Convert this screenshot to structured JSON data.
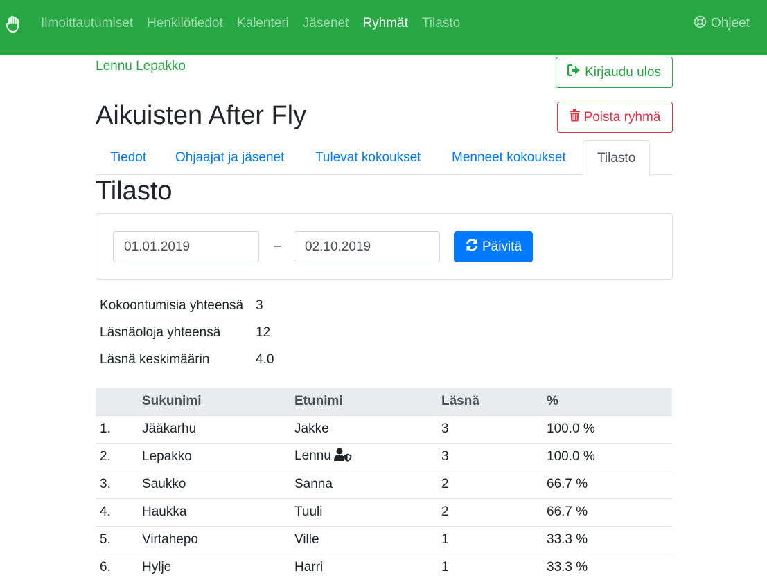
{
  "nav": {
    "items": [
      {
        "label": "Ilmoittautumiset",
        "active": false
      },
      {
        "label": "Henkilötiedot",
        "active": false
      },
      {
        "label": "Kalenteri",
        "active": false
      },
      {
        "label": "Jäsenet",
        "active": false
      },
      {
        "label": "Ryhmät",
        "active": true
      },
      {
        "label": "Tilasto",
        "active": false
      }
    ],
    "help_label": "Ohjeet",
    "brand_icon": "hand-icon"
  },
  "user": {
    "name": "Lennu Lepakko",
    "logout_label": "Kirjaudu ulos"
  },
  "group": {
    "title": "Aikuisten After Fly",
    "delete_label": "Poista ryhmä"
  },
  "tabs": [
    {
      "label": "Tiedot",
      "active": false
    },
    {
      "label": "Ohjaajat ja jäsenet",
      "active": false
    },
    {
      "label": "Tulevat kokoukset",
      "active": false
    },
    {
      "label": "Menneet kokoukset",
      "active": false
    },
    {
      "label": "Tilasto",
      "active": true
    }
  ],
  "stats_section": {
    "title": "Tilasto",
    "date_from": "01.01.2019",
    "date_separator": "–",
    "date_to": "02.10.2019",
    "refresh_label": "Päivitä"
  },
  "summary": [
    {
      "label": "Kokoontumisia yhteensä",
      "value": "3"
    },
    {
      "label": "Läsnäoloja yhteensä",
      "value": "12"
    },
    {
      "label": "Läsnä keskimäärin",
      "value": "4.0"
    }
  ],
  "table": {
    "headers": [
      "",
      "Sukunimi",
      "Etunimi",
      "Läsnä",
      "%"
    ],
    "rows": [
      {
        "n": "1.",
        "last": "Jääkarhu",
        "first": "Jakke",
        "present": "3",
        "pct": "100.0 %",
        "owner": false
      },
      {
        "n": "2.",
        "last": "Lepakko",
        "first": "Lennu",
        "present": "3",
        "pct": "100.0 %",
        "owner": true
      },
      {
        "n": "3.",
        "last": "Saukko",
        "first": "Sanna",
        "present": "2",
        "pct": "66.7 %",
        "owner": false
      },
      {
        "n": "4.",
        "last": "Haukka",
        "first": "Tuuli",
        "present": "2",
        "pct": "66.7 %",
        "owner": false
      },
      {
        "n": "5.",
        "last": "Virtahepo",
        "first": "Ville",
        "present": "1",
        "pct": "33.3 %",
        "owner": false
      },
      {
        "n": "6.",
        "last": "Hylje",
        "first": "Harri",
        "present": "1",
        "pct": "33.3 %",
        "owner": false
      }
    ]
  },
  "colors": {
    "navbar": "#28a745",
    "primary": "#007bff",
    "danger": "#dc3545",
    "success": "#28a745"
  }
}
